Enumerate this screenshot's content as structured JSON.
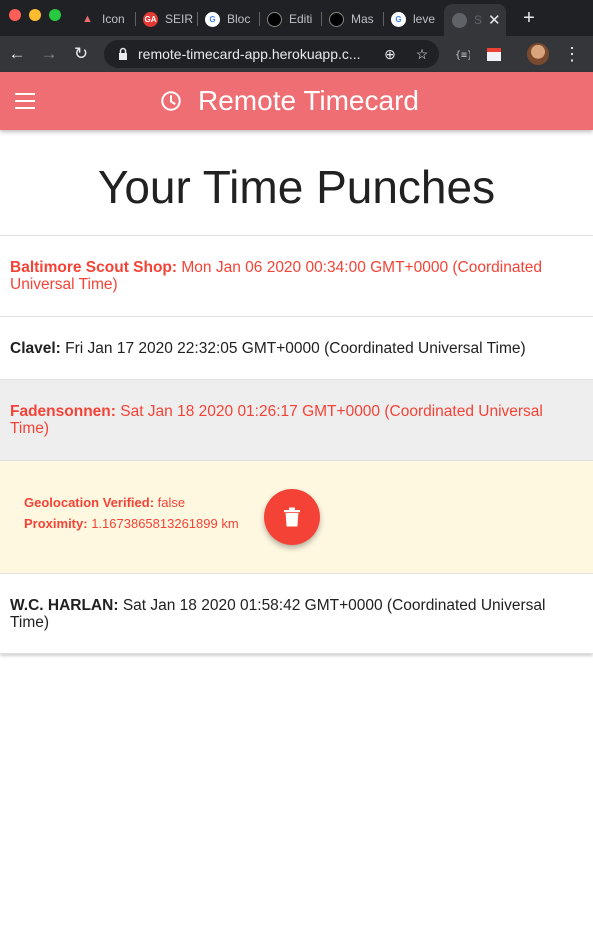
{
  "browser": {
    "tabs": [
      {
        "label": "Icon",
        "icon": "monster-icon"
      },
      {
        "label": "SEIR",
        "icon": "ga-icon"
      },
      {
        "label": "Bloc",
        "icon": "google-icon"
      },
      {
        "label": "Editi",
        "icon": "github-icon"
      },
      {
        "label": "Mas",
        "icon": "github-icon"
      },
      {
        "label": "leve",
        "icon": "google-icon"
      },
      {
        "label": "S",
        "icon": "globe-icon"
      }
    ],
    "url": "remote-timecard-app.herokuapp.c..."
  },
  "header": {
    "title": "Remote Timecard"
  },
  "page": {
    "title": "Your Time Punches"
  },
  "punches": [
    {
      "name": "Baltimore Scout Shop:",
      "time": "Mon Jan 06 2020 00:34:00 GMT+0000 (Coordinated Universal Time)"
    },
    {
      "name": "Clavel:",
      "time": "Fri Jan 17 2020 22:32:05 GMT+0000 (Coordinated Universal Time)"
    },
    {
      "name": "Fadensonnen:",
      "time": "Sat Jan 18 2020 01:26:17 GMT+0000 (Coordinated Universal Time)"
    },
    {
      "name": "W.C. HARLAN:",
      "time": "Sat Jan 18 2020 01:58:42 GMT+0000 (Coordinated Universal Time)"
    }
  ],
  "detail": {
    "geo_label": "Geolocation Verified:",
    "geo_value": "false",
    "prox_label": "Proximity:",
    "prox_value": "1.1673865813261899 km"
  },
  "colors": {
    "header_bg": "#ee6e73",
    "accent_red": "#f44336",
    "detail_bg": "#fff8e1"
  }
}
